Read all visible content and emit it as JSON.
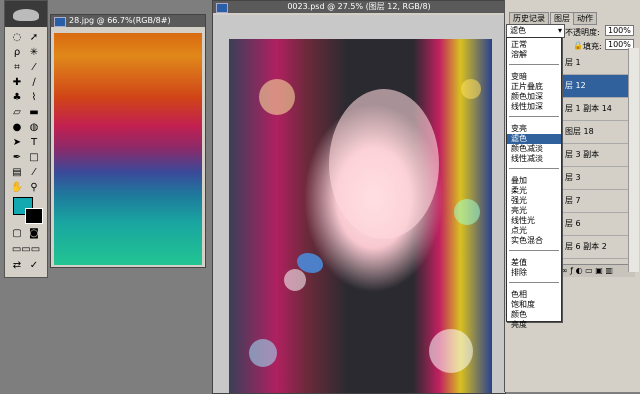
{
  "left_window": {
    "title": "28.jpg @ 66.7%(RGB/8#)"
  },
  "main_window": {
    "title": "0023.psd @ 27.5% (图层 12, RGB/8)"
  },
  "panel": {
    "tabs": [
      "历史记录",
      "图层",
      "动作"
    ],
    "blend_mode_value": "滤色",
    "opacity_label": "不透明度:",
    "opacity_value": "100%",
    "fill_label": "填充:",
    "fill_value": "100%",
    "layers": [
      "层 1",
      "层 12",
      "层 1 副本 14",
      "图层 18",
      "层 3 副本",
      "层 3",
      "层 7",
      "层 6",
      "层 6 副本 2"
    ],
    "selected_layer_index": 1
  },
  "blend_modes": {
    "groups": [
      [
        "正常",
        "溶解"
      ],
      [
        "变暗",
        "正片叠底",
        "颜色加深",
        "线性加深"
      ],
      [
        "变亮",
        "滤色",
        "颜色减淡",
        "线性减淡"
      ],
      [
        "叠加",
        "柔光",
        "强光",
        "亮光",
        "线性光",
        "点光",
        "实色混合"
      ],
      [
        "差值",
        "排除"
      ],
      [
        "色相",
        "饱和度",
        "颜色",
        "亮度"
      ]
    ],
    "selected": "滤色"
  },
  "colors": {
    "foreground": "#14a9b0",
    "background": "#000000",
    "selection": "#31619c"
  }
}
